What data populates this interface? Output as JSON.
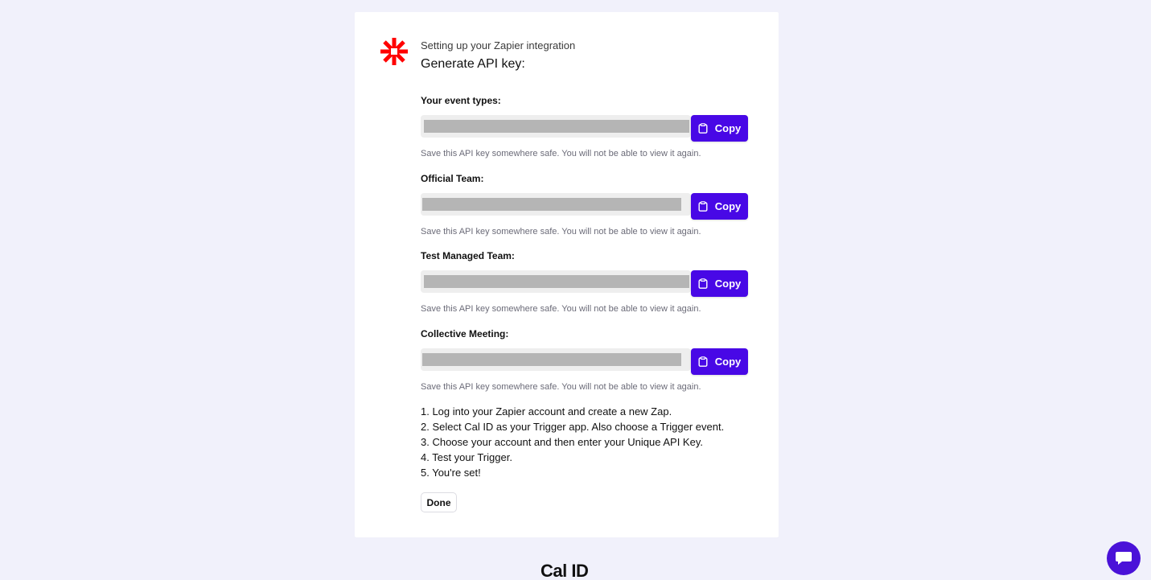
{
  "header": {
    "subtitle": "Setting up your Zapier integration",
    "title": "Generate API key:",
    "logo_icon": "zapier-asterisk-icon",
    "logo_color": "#ff0000"
  },
  "sections": [
    {
      "label": "Your event types:",
      "copy_label": "Copy",
      "hint": "Save this API key somewhere safe. You will not be able to view it again."
    },
    {
      "label": "Official Team:",
      "copy_label": "Copy",
      "hint": "Save this API key somewhere safe. You will not be able to view it again."
    },
    {
      "label": "Test Managed Team:",
      "copy_label": "Copy",
      "hint": "Save this API key somewhere safe. You will not be able to view it again."
    },
    {
      "label": "Collective Meeting:",
      "copy_label": "Copy",
      "hint": "Save this API key somewhere safe. You will not be able to view it again."
    }
  ],
  "steps": [
    "1. Log into your Zapier account and create a new Zap.",
    "2. Select Cal ID as your Trigger app. Also choose a Trigger event.",
    "3. Choose your account and then enter your Unique API Key.",
    "4. Test your Trigger.",
    "5. You're set!"
  ],
  "done_label": "Done",
  "footer": {
    "brand": "Cal ID"
  },
  "colors": {
    "accent": "#4808e6",
    "background": "#f1f1fb"
  },
  "chat": {
    "icon": "chat-bubble-icon"
  }
}
